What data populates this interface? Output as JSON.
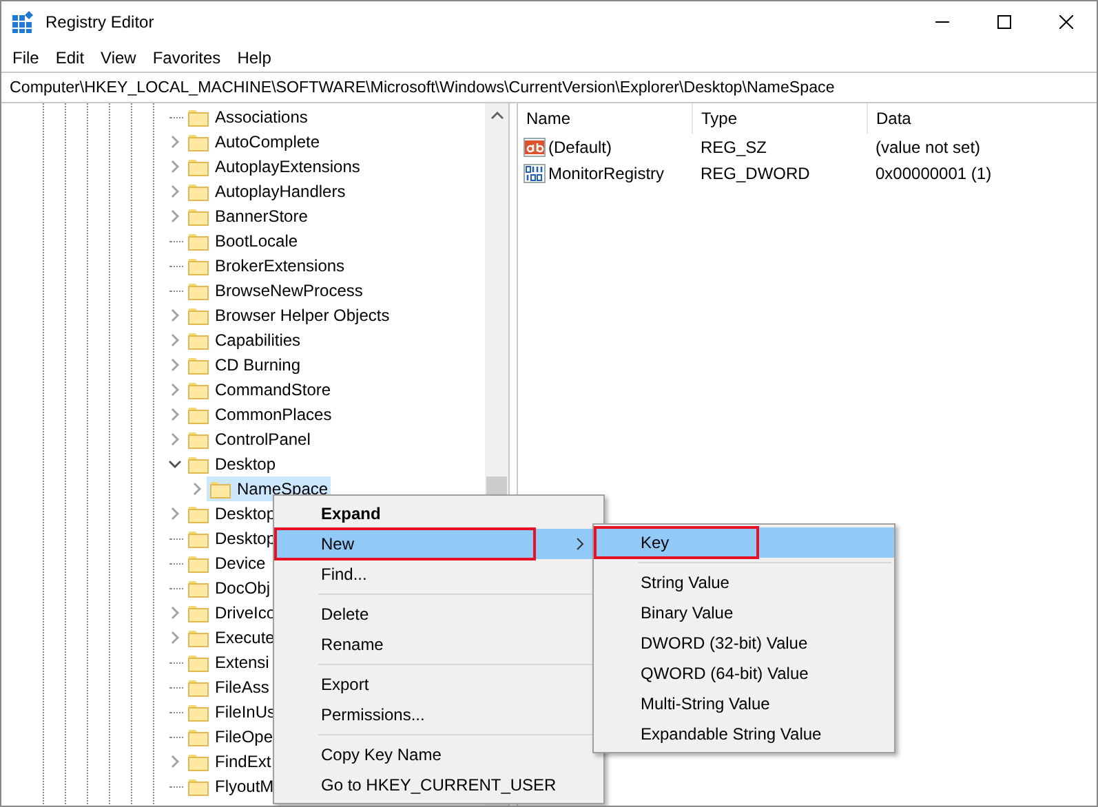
{
  "window": {
    "title": "Registry Editor"
  },
  "menu_bar": [
    "File",
    "Edit",
    "View",
    "Favorites",
    "Help"
  ],
  "address_bar": "Computer\\HKEY_LOCAL_MACHINE\\SOFTWARE\\Microsoft\\Windows\\CurrentVersion\\Explorer\\Desktop\\NameSpace",
  "tree": [
    {
      "label": "Associations",
      "expandable": false,
      "expanded": false,
      "selected": false
    },
    {
      "label": "AutoComplete",
      "expandable": true,
      "expanded": false,
      "selected": false
    },
    {
      "label": "AutoplayExtensions",
      "expandable": true,
      "expanded": false,
      "selected": false
    },
    {
      "label": "AutoplayHandlers",
      "expandable": true,
      "expanded": false,
      "selected": false
    },
    {
      "label": "BannerStore",
      "expandable": true,
      "expanded": false,
      "selected": false
    },
    {
      "label": "BootLocale",
      "expandable": false,
      "expanded": false,
      "selected": false
    },
    {
      "label": "BrokerExtensions",
      "expandable": false,
      "expanded": false,
      "selected": false
    },
    {
      "label": "BrowseNewProcess",
      "expandable": false,
      "expanded": false,
      "selected": false
    },
    {
      "label": "Browser Helper Objects",
      "expandable": true,
      "expanded": false,
      "selected": false
    },
    {
      "label": "Capabilities",
      "expandable": true,
      "expanded": false,
      "selected": false
    },
    {
      "label": "CD Burning",
      "expandable": true,
      "expanded": false,
      "selected": false
    },
    {
      "label": "CommandStore",
      "expandable": true,
      "expanded": false,
      "selected": false
    },
    {
      "label": "CommonPlaces",
      "expandable": true,
      "expanded": false,
      "selected": false
    },
    {
      "label": "ControlPanel",
      "expandable": true,
      "expanded": false,
      "selected": false
    },
    {
      "label": "Desktop",
      "expandable": true,
      "expanded": true,
      "selected": false,
      "children": [
        {
          "label": "NameSpace",
          "expandable": true,
          "expanded": false,
          "selected": true
        }
      ]
    },
    {
      "label": "Desktop",
      "expandable": true,
      "expanded": false,
      "selected": false
    },
    {
      "label": "Desktop",
      "expandable": false,
      "expanded": false,
      "selected": false
    },
    {
      "label": "Device",
      "expandable": false,
      "expanded": false,
      "selected": false
    },
    {
      "label": "DocObj",
      "expandable": false,
      "expanded": false,
      "selected": false
    },
    {
      "label": "DriveIco",
      "expandable": true,
      "expanded": false,
      "selected": false
    },
    {
      "label": "Execute",
      "expandable": true,
      "expanded": false,
      "selected": false
    },
    {
      "label": "Extensi",
      "expandable": false,
      "expanded": false,
      "selected": false
    },
    {
      "label": "FileAss",
      "expandable": false,
      "expanded": false,
      "selected": false
    },
    {
      "label": "FileInUs",
      "expandable": false,
      "expanded": false,
      "selected": false
    },
    {
      "label": "FileOpe",
      "expandable": false,
      "expanded": false,
      "selected": false
    },
    {
      "label": "FindExt",
      "expandable": true,
      "expanded": false,
      "selected": false
    },
    {
      "label": "FlyoutM",
      "expandable": false,
      "expanded": false,
      "selected": false
    }
  ],
  "values": {
    "columns": [
      "Name",
      "Type",
      "Data"
    ],
    "rows": [
      {
        "kind": "string",
        "name": "(Default)",
        "type": "REG_SZ",
        "data": "(value not set)"
      },
      {
        "kind": "binary",
        "name": "MonitorRegistry",
        "type": "REG_DWORD",
        "data": "0x00000001 (1)"
      }
    ]
  },
  "context_menu": [
    {
      "kind": "item",
      "label": "Expand",
      "default": true,
      "highlighted": false,
      "annotated": false
    },
    {
      "kind": "submenu",
      "label": "New",
      "default": false,
      "highlighted": true,
      "annotated": true
    },
    {
      "kind": "item",
      "label": "Find...",
      "default": false,
      "highlighted": false,
      "annotated": false
    },
    {
      "kind": "separator"
    },
    {
      "kind": "item",
      "label": "Delete",
      "default": false,
      "highlighted": false,
      "annotated": false
    },
    {
      "kind": "item",
      "label": "Rename",
      "default": false,
      "highlighted": false,
      "annotated": false
    },
    {
      "kind": "separator"
    },
    {
      "kind": "item",
      "label": "Export",
      "default": false,
      "highlighted": false,
      "annotated": false
    },
    {
      "kind": "item",
      "label": "Permissions...",
      "default": false,
      "highlighted": false,
      "annotated": false
    },
    {
      "kind": "separator"
    },
    {
      "kind": "item",
      "label": "Copy Key Name",
      "default": false,
      "highlighted": false,
      "annotated": false
    },
    {
      "kind": "item",
      "label": "Go to HKEY_CURRENT_USER",
      "default": false,
      "highlighted": false,
      "annotated": false
    }
  ],
  "new_submenu": [
    {
      "kind": "item",
      "label": "Key",
      "default": false,
      "highlighted": true,
      "annotated": true
    },
    {
      "kind": "separator"
    },
    {
      "kind": "item",
      "label": "String Value",
      "default": false,
      "highlighted": false,
      "annotated": false
    },
    {
      "kind": "item",
      "label": "Binary Value",
      "default": false,
      "highlighted": false,
      "annotated": false
    },
    {
      "kind": "item",
      "label": "DWORD (32-bit) Value",
      "default": false,
      "highlighted": false,
      "annotated": false
    },
    {
      "kind": "item",
      "label": "QWORD (64-bit) Value",
      "default": false,
      "highlighted": false,
      "annotated": false
    },
    {
      "kind": "item",
      "label": "Multi-String Value",
      "default": false,
      "highlighted": false,
      "annotated": false
    },
    {
      "kind": "item",
      "label": "Expandable String Value",
      "default": false,
      "highlighted": false,
      "annotated": false
    }
  ]
}
